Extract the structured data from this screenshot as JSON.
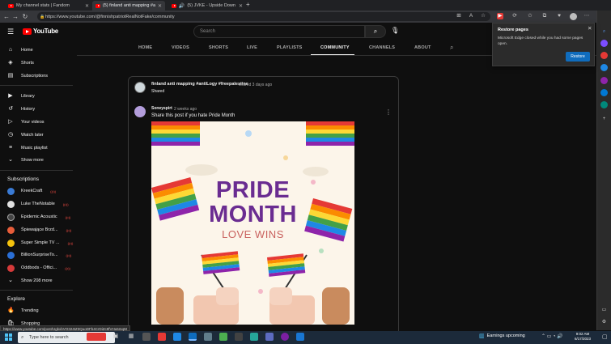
{
  "browser": {
    "tabs": [
      {
        "label": "My channel stats | Fandom"
      },
      {
        "label": "(5) finland anti mapping #antiLo"
      },
      {
        "label": "(5) JVKE - Upside Down (lyric"
      }
    ],
    "new_tab": "+",
    "url": "https://www.youtube.com/@finnishpatriotRealNotFake/community"
  },
  "youtube": {
    "logo_text": "YouTube",
    "search_placeholder": "Search",
    "channel_tabs": [
      "HOME",
      "VIDEOS",
      "SHORTS",
      "LIVE",
      "PLAYLISTS",
      "COMMUNITY",
      "CHANNELS",
      "ABOUT"
    ],
    "active_tab": "COMMUNITY",
    "sidebar": {
      "main": [
        {
          "label": "Home",
          "icon": "home-icon"
        },
        {
          "label": "Shorts",
          "icon": "shorts-icon"
        },
        {
          "label": "Subscriptions",
          "icon": "subscriptions-icon"
        }
      ],
      "library": [
        {
          "label": "Library",
          "icon": "library-icon"
        },
        {
          "label": "History",
          "icon": "history-icon"
        },
        {
          "label": "Your videos",
          "icon": "your-videos-icon"
        },
        {
          "label": "Watch later",
          "icon": "watch-later-icon"
        },
        {
          "label": "Music playlist",
          "icon": "playlist-icon"
        },
        {
          "label": "Show more",
          "icon": "chevron-down-icon"
        }
      ],
      "subscriptions_heading": "Subscriptions",
      "subscriptions": [
        {
          "label": "KreekCraft",
          "color": "#3a7bd5"
        },
        {
          "label": "Luke TheNotable",
          "color": "#e0e0e0"
        },
        {
          "label": "Epidemic Acoustic",
          "color": "#222222"
        },
        {
          "label": "Śpiewające Brzd...",
          "color": "#e85d3a"
        },
        {
          "label": "Super Simple TV ...",
          "color": "#f4c20d"
        },
        {
          "label": "BillionSurpriseTo...",
          "color": "#2a6fd6"
        },
        {
          "label": "Oddbods - Offici...",
          "color": "#d63a3a"
        }
      ],
      "show_more_subs": "Show 208 more",
      "explore_heading": "Explore",
      "explore": [
        {
          "label": "Trending",
          "icon": "trending-icon"
        },
        {
          "label": "Shopping",
          "icon": "shopping-icon"
        }
      ]
    },
    "post": {
      "shared_by": "finland anti mapping #antiLogy #freepalestine",
      "shared_meta": "shared 3 days ago",
      "shared_label": "Shared",
      "author": "Soneyspirt",
      "author_meta": "2 weeks ago",
      "text": "Share this post if you hate Pride Month",
      "image": {
        "headline": "PRIDE MONTH",
        "headline_line1": "PRIDE",
        "headline_line2": "MONTH",
        "subline": "LOVE WINS"
      }
    }
  },
  "restore_popup": {
    "title": "Restore pages",
    "message": "Microsoft Edge closed while you had some pages open.",
    "button": "Restore"
  },
  "status_url": "https://www.youtube.com/post/UgkxbVO324tZ3QuoDFb4CrDiZc8fVHu5mqM",
  "taskbar": {
    "search_placeholder": "Type here to search",
    "weather": "Earnings upcoming",
    "time": "9:02 AM",
    "date": "6/17/2023"
  },
  "colors": {
    "youtube_red": "#ff0000",
    "edge_blue": "#0f6cbd",
    "pride_purple": "#6a2c91",
    "love_wins": "#c9615e"
  }
}
